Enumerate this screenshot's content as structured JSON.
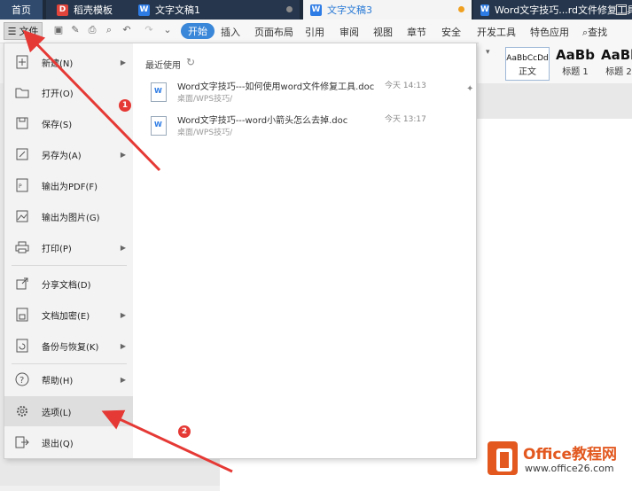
{
  "tabs": [
    {
      "label": "首页"
    },
    {
      "label": "稻壳模板",
      "icon": "daoke-red-icon"
    },
    {
      "label": "文字文稿1",
      "icon": "word-doc-icon"
    },
    {
      "label": "文字文稿3",
      "icon": "word-doc-icon"
    },
    {
      "label": "Word文字技巧...rd文件修复工具",
      "icon": "word-doc-icon"
    }
  ],
  "toolbar": {
    "file_label": "文件",
    "ribbon_tabs": [
      "开始",
      "插入",
      "页面布局",
      "引用",
      "审阅",
      "视图",
      "章节",
      "安全",
      "开发工具",
      "特色应用"
    ],
    "search_label": "查找"
  },
  "styles": {
    "normal_sample": "AaBbCcDd",
    "normal_label": "正文",
    "h1_sample": "AaBb",
    "h1_label": "标题 1",
    "h2_sample": "AaBb",
    "h2_label": "标题 2"
  },
  "file_menu": {
    "items": [
      {
        "label": "新建(N)",
        "icon": "new-doc-icon",
        "has_submenu": true
      },
      {
        "label": "打开(O)",
        "icon": "folder-open-icon",
        "has_submenu": false
      },
      {
        "label": "保存(S)",
        "icon": "save-icon",
        "has_submenu": false
      },
      {
        "label": "另存为(A)",
        "icon": "save-as-icon",
        "has_submenu": true
      },
      {
        "label": "输出为PDF(F)",
        "icon": "pdf-icon",
        "has_submenu": false
      },
      {
        "label": "输出为图片(G)",
        "icon": "image-icon",
        "has_submenu": false
      },
      {
        "label": "打印(P)",
        "icon": "print-icon",
        "has_submenu": true
      },
      {
        "label": "分享文档(D)",
        "icon": "share-icon",
        "has_submenu": false
      },
      {
        "label": "文档加密(E)",
        "icon": "encrypt-icon",
        "has_submenu": true
      },
      {
        "label": "备份与恢复(K)",
        "icon": "backup-icon",
        "has_submenu": true
      },
      {
        "label": "帮助(H)",
        "icon": "help-icon",
        "has_submenu": true
      },
      {
        "label": "选项(L)",
        "icon": "gear-icon",
        "has_submenu": false,
        "selected": true
      },
      {
        "label": "退出(Q)",
        "icon": "exit-icon",
        "has_submenu": false
      }
    ],
    "recent_title": "最近使用",
    "recent": [
      {
        "name": "Word文字技巧---如何使用word文件修复工具.doc",
        "path": "桌面/WPS技巧/",
        "time": "今天 14:13",
        "pinned_icon": true
      },
      {
        "name": "Word文字技巧---word小箭头怎么去掉.doc",
        "path": "桌面/WPS技巧/",
        "time": "今天 13:17",
        "pinned_icon": false
      }
    ]
  },
  "annotations": {
    "badge1": "1",
    "badge2": "2",
    "color": "#e53935"
  },
  "document_table": {
    "rows": [
      [
        "↵",
        "√",
        "↵",
        "↵",
        "↵",
        "↵"
      ],
      [
        "↵",
        "×",
        "↵",
        "↵",
        "↵",
        "↵"
      ],
      [
        "↵",
        "√",
        "√",
        "×",
        "√",
        "√"
      ],
      [
        "↵",
        "√",
        "×",
        "√",
        "√",
        "√"
      ],
      [
        "↵",
        "√",
        "×",
        "×",
        "√",
        "×"
      ],
      [
        "↵",
        "×",
        "√",
        "↵",
        "√",
        "↵"
      ]
    ]
  },
  "watermark": {
    "title": "Office教程网",
    "url": "www.office26.com"
  }
}
